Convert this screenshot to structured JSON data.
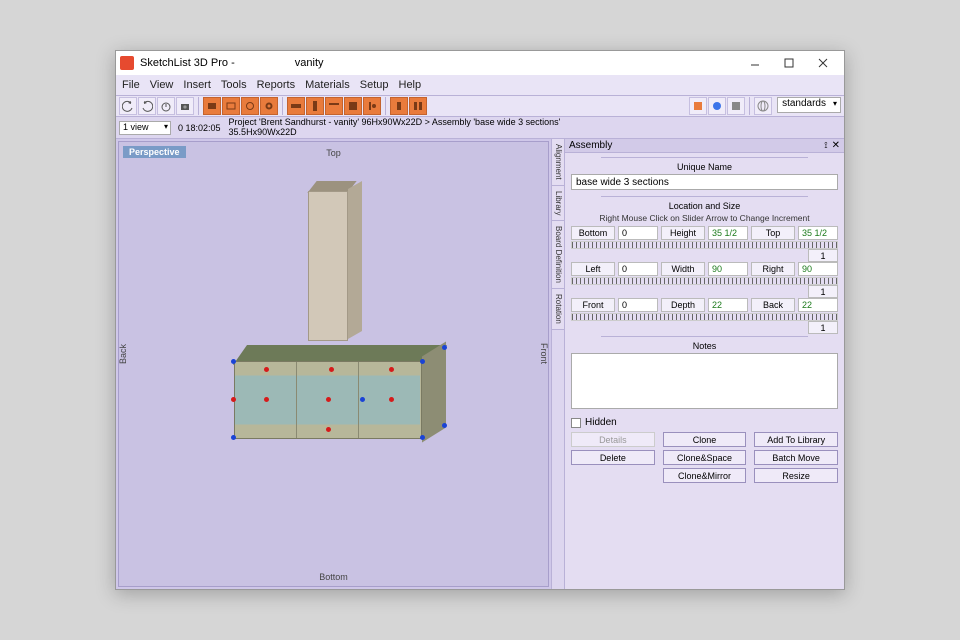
{
  "window": {
    "app_name": "SketchList 3D Pro -",
    "doc_name": "vanity"
  },
  "menu": [
    "File",
    "View",
    "Insert",
    "Tools",
    "Reports",
    "Materials",
    "Setup",
    "Help"
  ],
  "toolbar": {
    "standards_label": "standards"
  },
  "infobar": {
    "view_sel": "1 view",
    "timecode": "0 18:02:05",
    "crumb_line1": "Project 'Brent Sandhurst - vanity' 96Hx90Wx22D > Assembly 'base wide 3 sections'",
    "crumb_line2": "35.5Hx90Wx22D"
  },
  "viewport": {
    "badge": "Perspective",
    "top": "Top",
    "bottom": "Bottom",
    "left": "Back",
    "right": "Front"
  },
  "side_tabs": [
    "Alignment",
    "Library",
    "Board Definition",
    "Rotation"
  ],
  "panel": {
    "title": "Assembly",
    "unique_name_label": "Unique Name",
    "unique_name_value": "base wide 3 sections",
    "loc_size_label": "Location and Size",
    "loc_help": "Right Mouse Click on Slider Arrow to Change Increment",
    "rows": [
      {
        "a_lbl": "Bottom",
        "a_val": "0",
        "b_lbl": "Height",
        "b_val": "35 1/2",
        "c_lbl": "Top",
        "c_val": "35 1/2"
      },
      {
        "a_lbl": "Left",
        "a_val": "0",
        "b_lbl": "Width",
        "b_val": "90",
        "c_lbl": "Right",
        "c_val": "90"
      },
      {
        "a_lbl": "Front",
        "a_val": "0",
        "b_lbl": "Depth",
        "b_val": "22",
        "c_lbl": "Back",
        "c_val": "22"
      }
    ],
    "ruler_step": "1",
    "notes_label": "Notes",
    "hidden_label": "Hidden",
    "buttons": {
      "details": "Details",
      "clone": "Clone",
      "addlib": "Add To Library",
      "delete": "Delete",
      "clonespace": "Clone&Space",
      "batch": "Batch Move",
      "clonemirror": "Clone&Mirror",
      "resize": "Resize"
    }
  }
}
